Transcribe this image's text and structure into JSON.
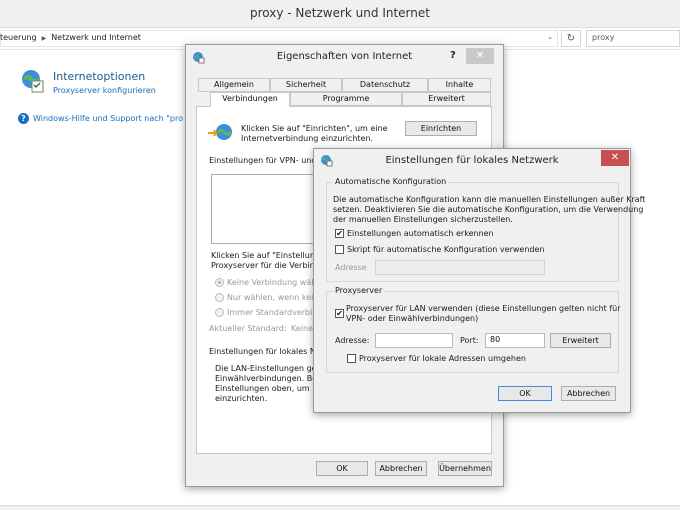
{
  "explorer": {
    "title": "proxy - Netzwerk und Internet",
    "breadcrumb": [
      "teuerung",
      "Netzwerk und Internet"
    ],
    "search_value": "proxy",
    "section_title": "Internetoptionen",
    "section_link": "Proxyserver konfigurieren",
    "help_link": "Windows-Hilfe und Support nach \"pro"
  },
  "internet_properties": {
    "title": "Eigenschaften von Internet",
    "help_glyph": "?",
    "close_glyph": "✕",
    "tabs_row1": [
      "Allgemein",
      "Sicherheit",
      "Datenschutz",
      "Inhalte"
    ],
    "tabs_row2": [
      "Verbindungen",
      "Programme",
      "Erweitert"
    ],
    "active_tab": "Verbindungen",
    "setup_text_1": "Klicken Sie auf \"Einrichten\", um eine",
    "setup_text_2": "Internetverbindung einzurichten.",
    "setup_button": "Einrichten",
    "vpn_label": "Einstellungen für VPN- und Ei",
    "click_text_1": "Klicken Sie auf \"Einstellunge",
    "click_text_2": "Proxyserver für die Verbindu",
    "radio_1": "Keine Verbindung wähle",
    "radio_2": "Nur wählen, wenn keine",
    "radio_3": "Immer Standardverbind",
    "current_default_label": "Aktueller Standard:",
    "current_default_value": "Keine",
    "lan_label": "Einstellungen für lokales Net",
    "lan_text_1": "Die LAN-Einstellungen gelte",
    "lan_text_2": "Einwählverbindungen. Bea",
    "lan_text_3": "Einstellungen oben, um Ein",
    "lan_text_4": "einzurichten.",
    "ok_button": "OK",
    "cancel_button": "Abbrechen",
    "apply_button": "Übernehmen"
  },
  "lan_settings": {
    "title": "Einstellungen für lokales Netzwerk",
    "close_glyph": "✕",
    "auto_config_legend": "Automatische Konfiguration",
    "auto_config_text_1": "Die automatische Konfiguration kann die manuellen Einstellungen außer Kraft",
    "auto_config_text_2": "setzen. Deaktivieren Sie die automatische Konfiguration, um die Verwendung",
    "auto_config_text_3": "der manuellen Einstellungen sicherzustellen.",
    "auto_detect_label": "Einstellungen automatisch erkennen",
    "auto_detect_checked": true,
    "script_label": "Skript für automatische Konfiguration verwenden",
    "script_checked": false,
    "script_address_label": "Adresse",
    "proxy_legend": "Proxyserver",
    "use_proxy_label_1": "Proxyserver für LAN verwenden (diese Einstellungen gelten nicht für",
    "use_proxy_label_2": "VPN- oder Einwählverbindungen)",
    "use_proxy_checked": true,
    "address_label": "Adresse:",
    "address_value": "",
    "port_label": "Port:",
    "port_value": "80",
    "advanced_button": "Erweitert",
    "bypass_label": "Proxyserver für lokale Adressen umgehen",
    "bypass_checked": false,
    "ok_button": "OK",
    "cancel_button": "Abbrechen"
  },
  "colors": {
    "close_red": "#c75050",
    "link_blue": "#1a6ebd",
    "title_blue": "#1e5a8a",
    "default_button_border": "#3d8ee0"
  }
}
